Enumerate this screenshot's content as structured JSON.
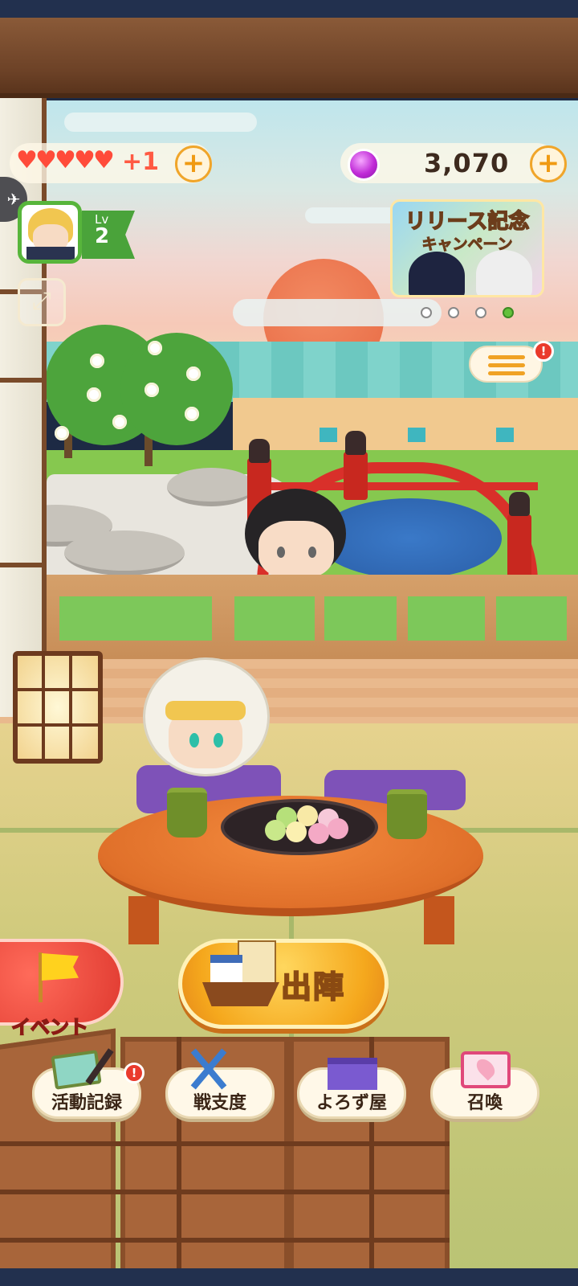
{
  "status_bar": {
    "hearts_count": 5,
    "hearts_bonus": "+1",
    "currency_amount": "3,070",
    "plus_symbol": "+",
    "colors": {
      "heart": "#ff4b3a",
      "plus": "#f09a12",
      "gem": "#c02bd7"
    }
  },
  "player": {
    "level_prefix": "Lv",
    "level": "2"
  },
  "banner": {
    "title": "リリース記念",
    "subtitle": "キャンペーン",
    "page_total": 4,
    "page_active": 4
  },
  "menu": {
    "badge": "!"
  },
  "actions": {
    "event_label": "イベント",
    "sortie_label": "出陣"
  },
  "bottom_nav": [
    {
      "label": "活動記録",
      "icon": "paw-canvas-icon",
      "badge": "!"
    },
    {
      "label": "戦支度",
      "icon": "crossed-swords-icon",
      "badge": ""
    },
    {
      "label": "よろず屋",
      "icon": "shop-curtain-icon",
      "badge": ""
    },
    {
      "label": "召喚",
      "icon": "summon-scroll-icon",
      "badge": ""
    }
  ],
  "icons": {
    "share": "share-icon",
    "expand": "expand-icon",
    "menu": "hamburger-menu-icon",
    "currency": "gem-icon",
    "hearts": "heart-icon"
  }
}
